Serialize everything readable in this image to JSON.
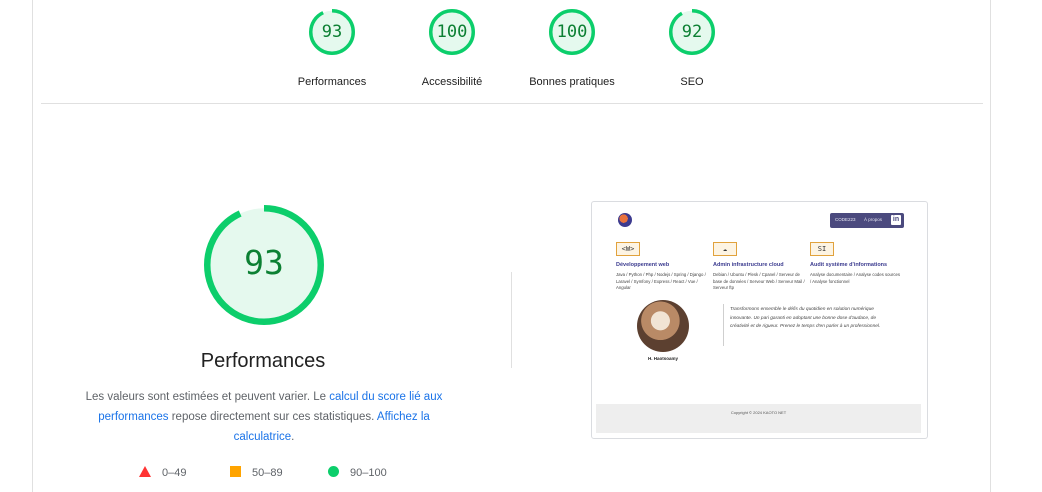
{
  "scores": [
    {
      "label": "Performances",
      "value": "93",
      "fraction": 0.93
    },
    {
      "label": "Accessibilité",
      "value": "100",
      "fraction": 1.0
    },
    {
      "label": "Bonnes pratiques",
      "value": "100",
      "fraction": 1.0
    },
    {
      "label": "SEO",
      "value": "92",
      "fraction": 0.92
    }
  ],
  "main": {
    "score": "93",
    "fraction": 0.93,
    "title": "Performances",
    "desc_text_1": "Les valeurs sont estimées et peuvent varier. Le ",
    "desc_link_1": "calcul du score lié aux performances",
    "desc_text_2": " repose directement sur ces statistiques. ",
    "desc_link_2": "Affichez la calculatrice",
    "desc_text_3": "."
  },
  "legend": [
    {
      "shape": "triangle",
      "range": "0–49",
      "color": "#ff3333"
    },
    {
      "shape": "square",
      "range": "50–89",
      "color": "#ffa400"
    },
    {
      "shape": "circle",
      "range": "90–100",
      "color": "#0cce6b"
    }
  ],
  "colors": {
    "pass": "#0cce6b",
    "pass_text": "#0c8033",
    "pass_fill": "#e5f9ee",
    "link": "#1a73e8"
  },
  "screenshot": {
    "nav_items": [
      "CODE223",
      "À propos"
    ],
    "nav_icon": "in",
    "services": [
      {
        "icon": "<W>",
        "title": "Développement web",
        "desc": "Java / Python / Php / Nodejs / Spring / Django / Laravel / Symfony / Express / React / Vue / Angular"
      },
      {
        "icon": "☁",
        "title": "Admin infrastructure cloud",
        "desc": "Debian / Ubuntu / Plesk / Cpanel / Serveur de base de données / Serveur Web / Serveur Mail / Serveur ftp"
      },
      {
        "icon": "SI",
        "title": "Audit système d'informations",
        "desc": "Analyse documentaire / Analyse codes sources / Analyse fonctionnel"
      }
    ],
    "author": "H. Haotsoamy",
    "quote": "Transformons ensemble le défis du quotidien en solution numérique innovante. Un pari garanti en adoptant une bonne dose d'audace, de créativité et de rigueur. Prenez le temps d'en parler à un professionnel.",
    "footer": "Copyright © 2024 KAOTO NET"
  }
}
